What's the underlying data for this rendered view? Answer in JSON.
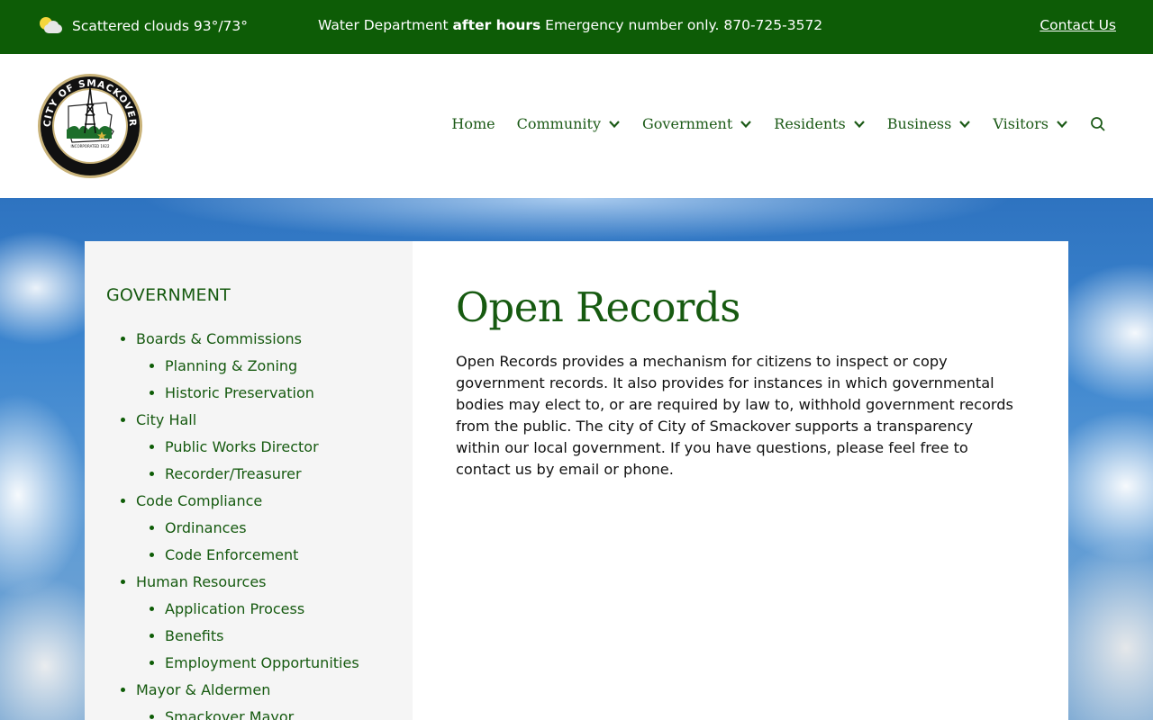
{
  "topbar": {
    "weather_text": "Scattered clouds 93°/73°",
    "weather_icon": "partly-cloudy-icon",
    "alert_prefix": "Water Department ",
    "alert_bold": "after hours",
    "alert_suffix": " Emergency number only. 870-725-3572",
    "contact_label": "Contact Us"
  },
  "header": {
    "logo_icon": "city-seal-logo",
    "logo_text_top": "CITY OF SMACKOVER",
    "logo_text_bottom": "ARKANSAS",
    "logo_text_inc": "INCORPORATED 1922",
    "nav": {
      "home": "Home",
      "community": "Community",
      "government": "Government",
      "residents": "Residents",
      "business": "Business",
      "visitors": "Visitors"
    }
  },
  "sidebar": {
    "title": "GOVERNMENT",
    "boards": "Boards & Commissions",
    "planning": "Planning & Zoning",
    "historic": "Historic Preservation",
    "cityhall": "City Hall",
    "publicworks": "Public Works Director",
    "recorder": "Recorder/Treasurer",
    "code": "Code Compliance",
    "ordinances": "Ordinances",
    "enforcement": "Code Enforcement",
    "hr": "Human Resources",
    "application": "Application Process",
    "benefits": "Benefits",
    "employment": "Employment Opportunities",
    "mayor": "Mayor & Aldermen",
    "smackover_mayor": "Smackover Mayor"
  },
  "main": {
    "title": "Open Records",
    "body": "Open Records provides a mechanism for citizens to inspect or copy government records. It also provides for instances in which governmental bodies may elect to, or are required by law to, withhold government records from the public. The city of City of Smackover supports a transparency within our local government.  If you have questions, please feel free to contact us by email or phone."
  },
  "colors": {
    "brand_green": "#0d5c06",
    "link_green": "#165a10"
  }
}
